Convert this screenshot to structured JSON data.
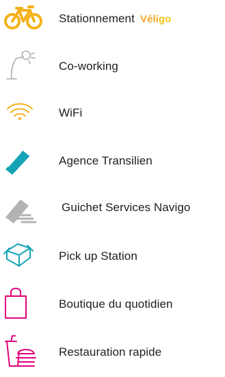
{
  "colors": {
    "yellow": "#f5b21b",
    "grey": "#b3b3b3",
    "teal": "#16a3b7",
    "pink": "#e2007a",
    "text": "#1d1d1b"
  },
  "items": [
    {
      "icon": "bicycle-icon",
      "label": "Stationnement",
      "brand": {
        "part1": "Véli",
        "part2": "go"
      }
    },
    {
      "icon": "desk-lamp-icon",
      "label": "Co-working"
    },
    {
      "icon": "wifi-icon",
      "label": "WiFi"
    },
    {
      "icon": "transit-card-icon",
      "label": "Agence Transilien"
    },
    {
      "icon": "card-counter-icon",
      "label": "Guichet Services Navigo"
    },
    {
      "icon": "parcel-box-icon",
      "label": "Pick up Station"
    },
    {
      "icon": "shopping-bag-icon",
      "label": "Boutique du quotidien"
    },
    {
      "icon": "fast-food-icon",
      "label": "Restauration rapide"
    }
  ]
}
